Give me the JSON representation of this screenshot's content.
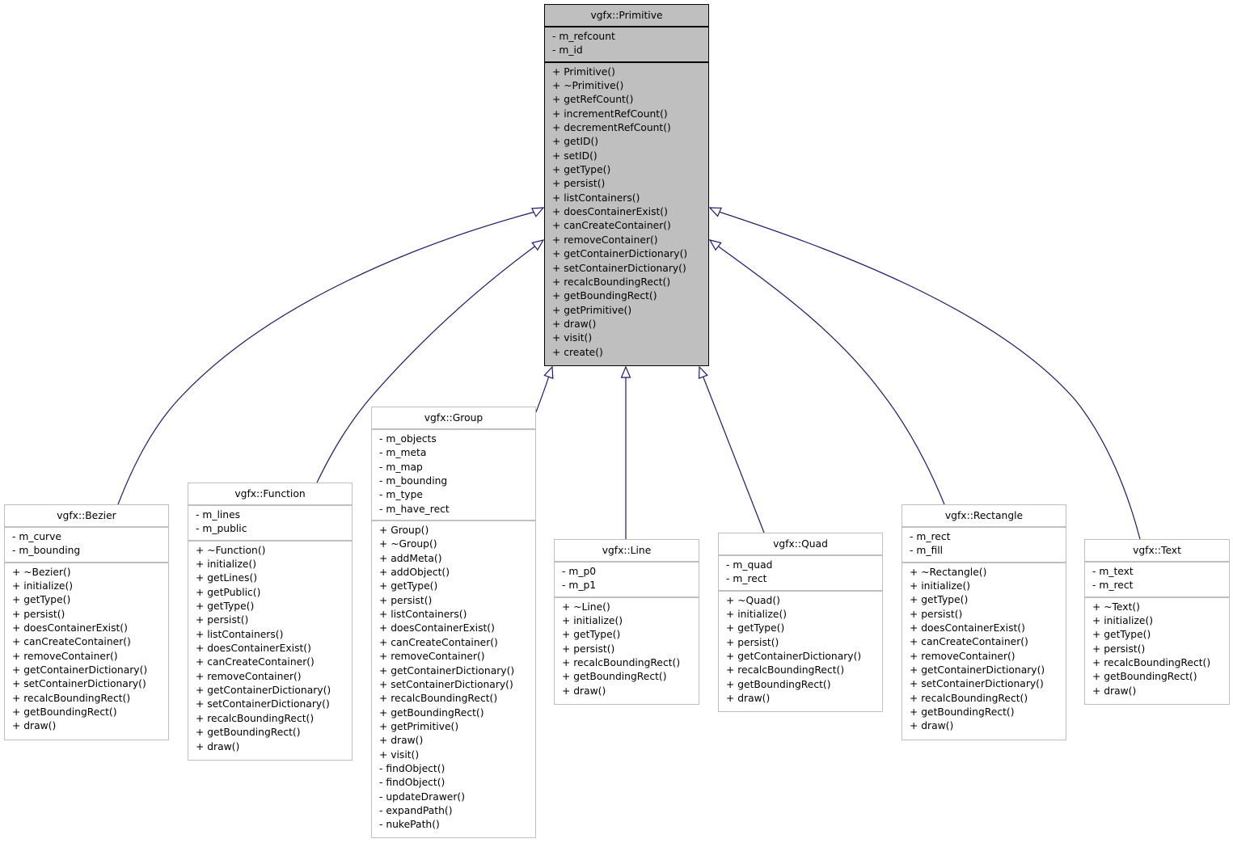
{
  "diagram": {
    "type": "class-inheritance",
    "edge_color": "#191970",
    "base_fill": "#bfbfbf",
    "derived_border": "#bfbfbf",
    "classes": {
      "primitive": {
        "name": "vgfx::Primitive",
        "attributes": [
          "- m_refcount",
          "- m_id"
        ],
        "methods": [
          "+ Primitive()",
          "+ ~Primitive()",
          "+ getRefCount()",
          "+ incrementRefCount()",
          "+ decrementRefCount()",
          "+ getID()",
          "+ setID()",
          "+ getType()",
          "+ persist()",
          "+ listContainers()",
          "+ doesContainerExist()",
          "+ canCreateContainer()",
          "+ removeContainer()",
          "+ getContainerDictionary()",
          "+ setContainerDictionary()",
          "+ recalcBoundingRect()",
          "+ getBoundingRect()",
          "+ getPrimitive()",
          "+ draw()",
          "+ visit()",
          "+ create()"
        ]
      },
      "bezier": {
        "name": "vgfx::Bezier",
        "attributes": [
          "- m_curve",
          "- m_bounding"
        ],
        "methods": [
          "+ ~Bezier()",
          "+ initialize()",
          "+ getType()",
          "+ persist()",
          "+ doesContainerExist()",
          "+ canCreateContainer()",
          "+ removeContainer()",
          "+ getContainerDictionary()",
          "+ setContainerDictionary()",
          "+ recalcBoundingRect()",
          "+ getBoundingRect()",
          "+ draw()"
        ]
      },
      "function": {
        "name": "vgfx::Function",
        "attributes": [
          "- m_lines",
          "- m_public"
        ],
        "methods": [
          "+ ~Function()",
          "+ initialize()",
          "+ getLines()",
          "+ getPublic()",
          "+ getType()",
          "+ persist()",
          "+ listContainers()",
          "+ doesContainerExist()",
          "+ canCreateContainer()",
          "+ removeContainer()",
          "+ getContainerDictionary()",
          "+ setContainerDictionary()",
          "+ recalcBoundingRect()",
          "+ getBoundingRect()",
          "+ draw()"
        ]
      },
      "group": {
        "name": "vgfx::Group",
        "attributes": [
          "- m_objects",
          "- m_meta",
          "- m_map",
          "- m_bounding",
          "- m_type",
          "- m_have_rect"
        ],
        "methods": [
          "+ Group()",
          "+ ~Group()",
          "+ addMeta()",
          "+ addObject()",
          "+ getType()",
          "+ persist()",
          "+ listContainers()",
          "+ doesContainerExist()",
          "+ canCreateContainer()",
          "+ removeContainer()",
          "+ getContainerDictionary()",
          "+ setContainerDictionary()",
          "+ recalcBoundingRect()",
          "+ getBoundingRect()",
          "+ getPrimitive()",
          "+ draw()",
          "+ visit()",
          "- findObject()",
          "- findObject()",
          "- updateDrawer()",
          "- expandPath()",
          "- nukePath()"
        ]
      },
      "line": {
        "name": "vgfx::Line",
        "attributes": [
          "- m_p0",
          "- m_p1"
        ],
        "methods": [
          "+ ~Line()",
          "+ initialize()",
          "+ getType()",
          "+ persist()",
          "+ recalcBoundingRect()",
          "+ getBoundingRect()",
          "+ draw()"
        ]
      },
      "quad": {
        "name": "vgfx::Quad",
        "attributes": [
          "- m_quad",
          "- m_rect"
        ],
        "methods": [
          "+ ~Quad()",
          "+ initialize()",
          "+ getType()",
          "+ persist()",
          "+ getContainerDictionary()",
          "+ recalcBoundingRect()",
          "+ getBoundingRect()",
          "+ draw()"
        ]
      },
      "rectangle": {
        "name": "vgfx::Rectangle",
        "attributes": [
          "- m_rect",
          "- m_fill"
        ],
        "methods": [
          "+ ~Rectangle()",
          "+ initialize()",
          "+ getType()",
          "+ persist()",
          "+ doesContainerExist()",
          "+ canCreateContainer()",
          "+ removeContainer()",
          "+ getContainerDictionary()",
          "+ setContainerDictionary()",
          "+ recalcBoundingRect()",
          "+ getBoundingRect()",
          "+ draw()"
        ]
      },
      "text": {
        "name": "vgfx::Text",
        "attributes": [
          "- m_text",
          "- m_rect"
        ],
        "methods": [
          "+ ~Text()",
          "+ initialize()",
          "+ getType()",
          "+ persist()",
          "+ recalcBoundingRect()",
          "+ getBoundingRect()",
          "+ draw()"
        ]
      }
    },
    "inheritance": [
      {
        "from": "bezier",
        "to": "primitive"
      },
      {
        "from": "function",
        "to": "primitive"
      },
      {
        "from": "group",
        "to": "primitive"
      },
      {
        "from": "line",
        "to": "primitive"
      },
      {
        "from": "quad",
        "to": "primitive"
      },
      {
        "from": "rectangle",
        "to": "primitive"
      },
      {
        "from": "text",
        "to": "primitive"
      }
    ]
  }
}
